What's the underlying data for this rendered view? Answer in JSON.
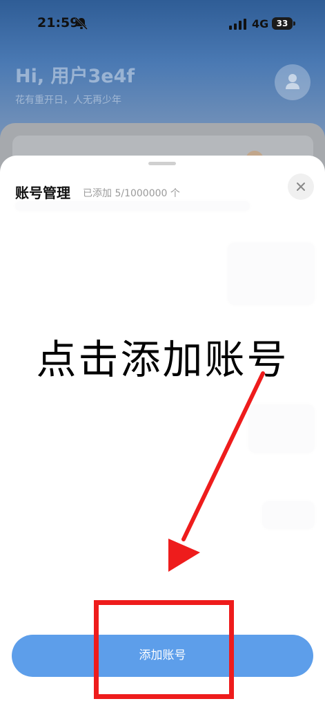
{
  "status_bar": {
    "time": "21:59",
    "network": "4G",
    "battery": "33"
  },
  "background_app": {
    "greeting": "Hi, 用户3e4f",
    "subtitle": "花有重开日，人无再少年"
  },
  "sheet": {
    "title": "账号管理",
    "count_text": "已添加 5/1000000 个",
    "add_button_label": "添加账号"
  },
  "annotation": {
    "text": "点击添加账号",
    "color": "#ee1c1c"
  },
  "colors": {
    "button": "#5d9eea",
    "header_gradient": "#2f5d96"
  }
}
